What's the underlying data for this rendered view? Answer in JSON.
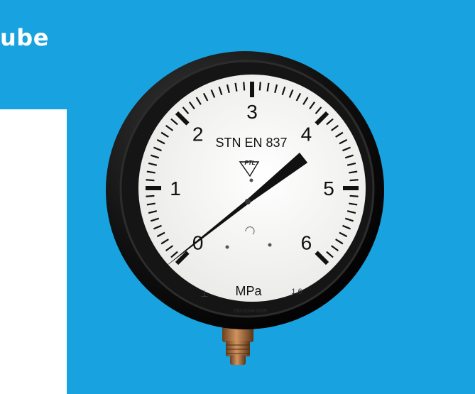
{
  "header": {
    "title_fragment": "ube"
  },
  "gauge": {
    "standard": "STN EN 837",
    "logo": "PTL",
    "unit": "MPa",
    "accuracy_class": "1,6",
    "serial": "250-1034-2009",
    "mount_symbol": "⊥",
    "scale_labels": [
      "0",
      "1",
      "2",
      "3",
      "4",
      "5",
      "6"
    ],
    "scale_min": 0,
    "scale_max": 6,
    "reading": 4.15
  },
  "colors": {
    "background": "#18a3e0",
    "bezel": "#0d0d0d",
    "dial": "#f4f4f2",
    "pointer": "#111111",
    "stem": "#a86b3c"
  }
}
